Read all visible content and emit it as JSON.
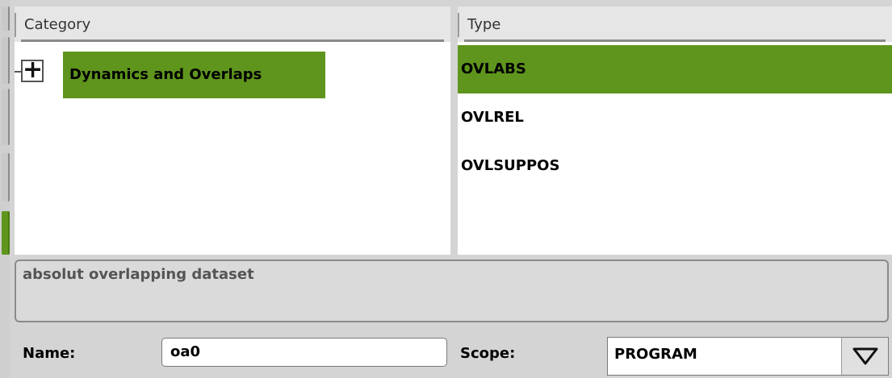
{
  "category_panel": {
    "header": "Category",
    "tree": [
      {
        "label": "Dynamics and Overlaps",
        "expander": "+",
        "selected": true
      }
    ]
  },
  "type_panel": {
    "header": "Type",
    "items": [
      {
        "label": "OVLABS",
        "selected": true
      },
      {
        "label": "OVLREL",
        "selected": false
      },
      {
        "label": "OVLSUPPOS",
        "selected": false
      }
    ]
  },
  "description": "absolut overlapping dataset",
  "name_field": {
    "label": "Name:",
    "value": "oa0"
  },
  "scope_field": {
    "label": "Scope:",
    "value": "PROGRAM",
    "icon": "triangle-down-icon"
  },
  "colors": {
    "selection": "#5f951d",
    "background": "#d4d4d4",
    "panel": "#ffffff"
  }
}
